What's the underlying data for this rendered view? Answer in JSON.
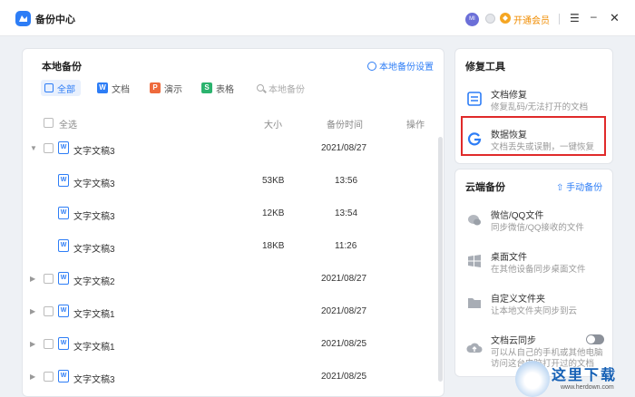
{
  "app": {
    "title": "备份中心",
    "avatar_text": "MI",
    "vip_label": "开通会员"
  },
  "main": {
    "title": "本地备份",
    "settings_link": "本地备份设置",
    "filters": [
      {
        "label": "全部",
        "icon": "all-icon"
      },
      {
        "label": "文档",
        "icon": "W"
      },
      {
        "label": "演示",
        "icon": "P"
      },
      {
        "label": "表格",
        "icon": "S"
      }
    ],
    "search_placeholder": "本地备份",
    "columns": {
      "select_all": "全选",
      "size": "大小",
      "time": "备份时间",
      "action": "操作"
    },
    "rows": [
      {
        "name": "文字文稿3",
        "size": "",
        "time": "2021/08/27",
        "expanded": true
      },
      {
        "name": "文字文稿3",
        "size": "53KB",
        "time": "13:56"
      },
      {
        "name": "文字文稿3",
        "size": "12KB",
        "time": "13:54"
      },
      {
        "name": "文字文稿3",
        "size": "18KB",
        "time": "11:26"
      },
      {
        "name": "文字文稿2",
        "size": "",
        "time": "2021/08/27"
      },
      {
        "name": "文字文稿1",
        "size": "",
        "time": "2021/08/27"
      },
      {
        "name": "文字文稿1",
        "size": "",
        "time": "2021/08/25"
      },
      {
        "name": "文字文稿3",
        "size": "",
        "time": "2021/08/25"
      }
    ],
    "doc_icon_letter": "W"
  },
  "repair": {
    "title": "修复工具",
    "items": [
      {
        "title": "文档修复",
        "desc": "修复乱码/无法打开的文档"
      },
      {
        "title": "数据恢复",
        "desc": "文档丢失或误删，一键恢复"
      }
    ]
  },
  "cloud": {
    "title": "云端备份",
    "manual_link": "手动备份",
    "items": [
      {
        "title": "微信/QQ文件",
        "desc": "同步微信/QQ接收的文件"
      },
      {
        "title": "桌面文件",
        "desc": "在其他设备同步桌面文件"
      },
      {
        "title": "自定义文件夹",
        "desc": "让本地文件夹同步到云"
      },
      {
        "title": "文档云同步",
        "desc": "可以从自己的手机或其他电脑",
        "desc2": "访问这台电脑打开过的文档"
      }
    ]
  },
  "watermark": {
    "text": "这里下载",
    "url": "www.herdown.com"
  },
  "colors": {
    "accent": "#2d7df6",
    "vip": "#f08c00",
    "highlight": "#e02a2a"
  }
}
